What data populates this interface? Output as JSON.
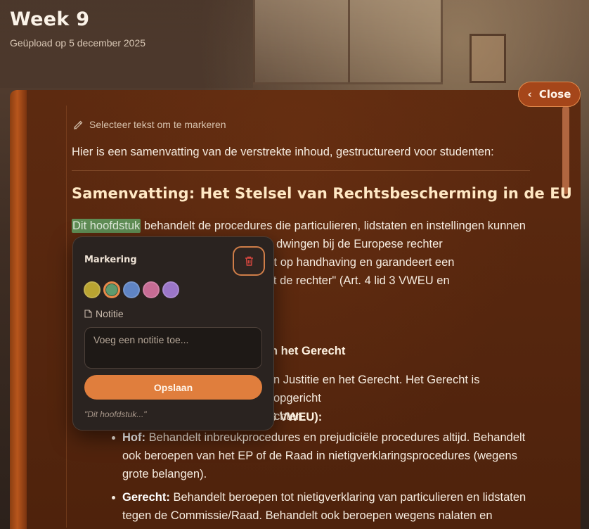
{
  "header": {
    "title": "Week 9",
    "subtitle": "Geüpload op 5 december 2025"
  },
  "close_button": {
    "label": "Close",
    "icon": "chevron-left-icon"
  },
  "reader": {
    "hint": "Selecteer tekst om te markeren",
    "intro": "Hier is een samenvatting van de verstrekte inhoud, gestructureerd voor studenten:",
    "heading": "Samenvatting: Het Stelsel van Rechtsbescherming in de EU",
    "para1": {
      "highlight": "Dit hoofdstuk",
      "rest_line1": " behandelt de procedures die particulieren, lidstaten en instellingen kunnen",
      "line2_end": "ees recht af te dwingen bij de Europese rechter",
      "line3_end": "telsel is gericht op handhaving en garandeert een",
      "line4_end": "en toegang tot de rechter\" (Art. 4 lid 3 VWEU en"
    },
    "section_heading_end": "n het Gerecht",
    "para2": {
      "line1_end": "n Justitie en het Gerecht. Het Gerecht is opgericht",
      "line2_end": "chten."
    },
    "sub_heading_end": "6 VWEU):",
    "bullets": [
      {
        "term": "Hof:",
        "text": " Behandelt inbreukprocedures en prejudiciële procedures altijd. Behandelt ook beroepen van het EP of de Raad in nietigverklaringsprocedures (wegens grote belangen)."
      },
      {
        "term": "Gerecht:",
        "text": " Behandelt beroepen tot nietigverklaring van particulieren en lidstaten tegen de Commissie/Raad. Behandelt ook beroepen wegens nalaten en"
      }
    ]
  },
  "popover": {
    "title": "Markering",
    "delete_icon": "trash-icon",
    "colors": [
      {
        "name": "yellow",
        "hex": "#b9a431",
        "selected": false
      },
      {
        "name": "green",
        "hex": "#5f9a6e",
        "selected": true
      },
      {
        "name": "blue",
        "hex": "#5f84c4",
        "selected": false
      },
      {
        "name": "pink",
        "hex": "#c76c94",
        "selected": false
      },
      {
        "name": "purple",
        "hex": "#9b76c8",
        "selected": false
      }
    ],
    "note_label": "Notitie",
    "note_placeholder": "Voeg een notitie toe...",
    "save_label": "Opslaan",
    "quote": "\"Dit hoofdstuk...\""
  }
}
